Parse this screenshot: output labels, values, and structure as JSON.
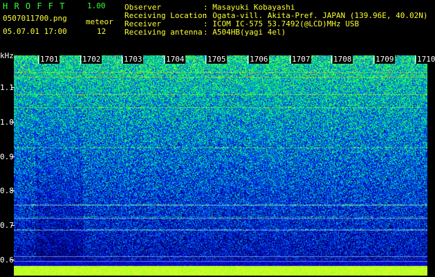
{
  "header": {
    "title": "H R O F F T",
    "version": "1.00",
    "filename": "0507011700.png",
    "meteor_label": "meteor",
    "datetime": "05.07.01 17:00",
    "meteor_count": "12"
  },
  "info": {
    "observer_label": "Observer",
    "observer_value": ": Masayuki Kobayashi",
    "location_label": "Receiving Location",
    "location_value": ": Ogata-vill. Akita-Pref. JAPAN (139.96E, 40.02N)",
    "receiver_label": "Receiver",
    "receiver_value": ": ICOM IC-575 53.7492(@LCD)MHz USB",
    "antenna_label": "Receiving antenna",
    "antenna_value": ": A504HB(yagi 4el)"
  },
  "axis": {
    "unit": "kHz",
    "y_labels": [
      "1.1",
      "1.0",
      "0.9",
      "0.8",
      "0.7",
      "0.6"
    ],
    "time_labels": [
      "1701",
      "1702",
      "1703",
      "1704",
      "1705",
      "1706",
      "1707",
      "1708",
      "1709",
      "1710"
    ]
  },
  "colors": {
    "title_green": "#33ff33",
    "info_yellow": "#ffff33",
    "background": "#000000"
  }
}
